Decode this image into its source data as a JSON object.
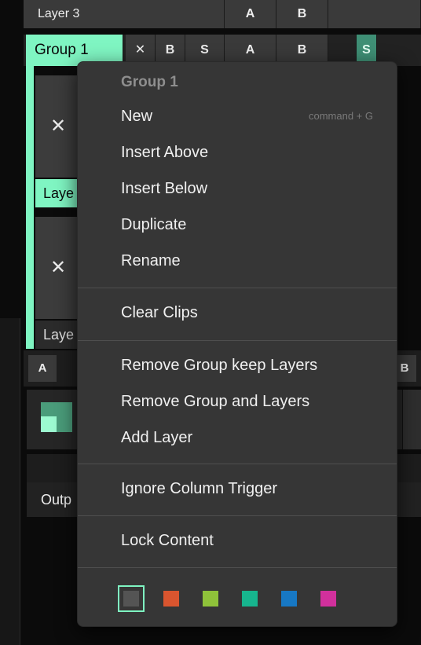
{
  "background": {
    "layer3": {
      "name": "Layer 3",
      "a_label": "A",
      "b_label": "B"
    },
    "group": {
      "name": "Group 1",
      "x_label": "✕",
      "b_label": "B",
      "s_label": "S",
      "a_label": "A",
      "b2_label": "B",
      "solo_label": "S"
    },
    "tiles": [
      {
        "close": "✕",
        "label": "Laye"
      },
      {
        "close": "✕",
        "label": "Laye"
      }
    ],
    "deck_tab_a": "A",
    "deck_tab_b": "B",
    "output_label": "Outp"
  },
  "menu": {
    "header": "Group 1",
    "items": [
      {
        "label": "New",
        "shortcut": "command + G"
      },
      {
        "label": "Insert Above"
      },
      {
        "label": "Insert Below"
      },
      {
        "label": "Duplicate"
      },
      {
        "label": "Rename"
      },
      {
        "label": "Clear Clips"
      },
      {
        "label": "Remove Group keep Layers"
      },
      {
        "label": "Remove Group and Layers"
      },
      {
        "label": "Add Layer"
      },
      {
        "label": "Ignore Column Trigger"
      },
      {
        "label": "Lock Content"
      }
    ],
    "colors": [
      "#545454",
      "#d9552f",
      "#8fc33a",
      "#17b58e",
      "#1778c4",
      "#d1309c"
    ],
    "selected_color_index": 0
  },
  "accent_color": "#7ff5c2"
}
